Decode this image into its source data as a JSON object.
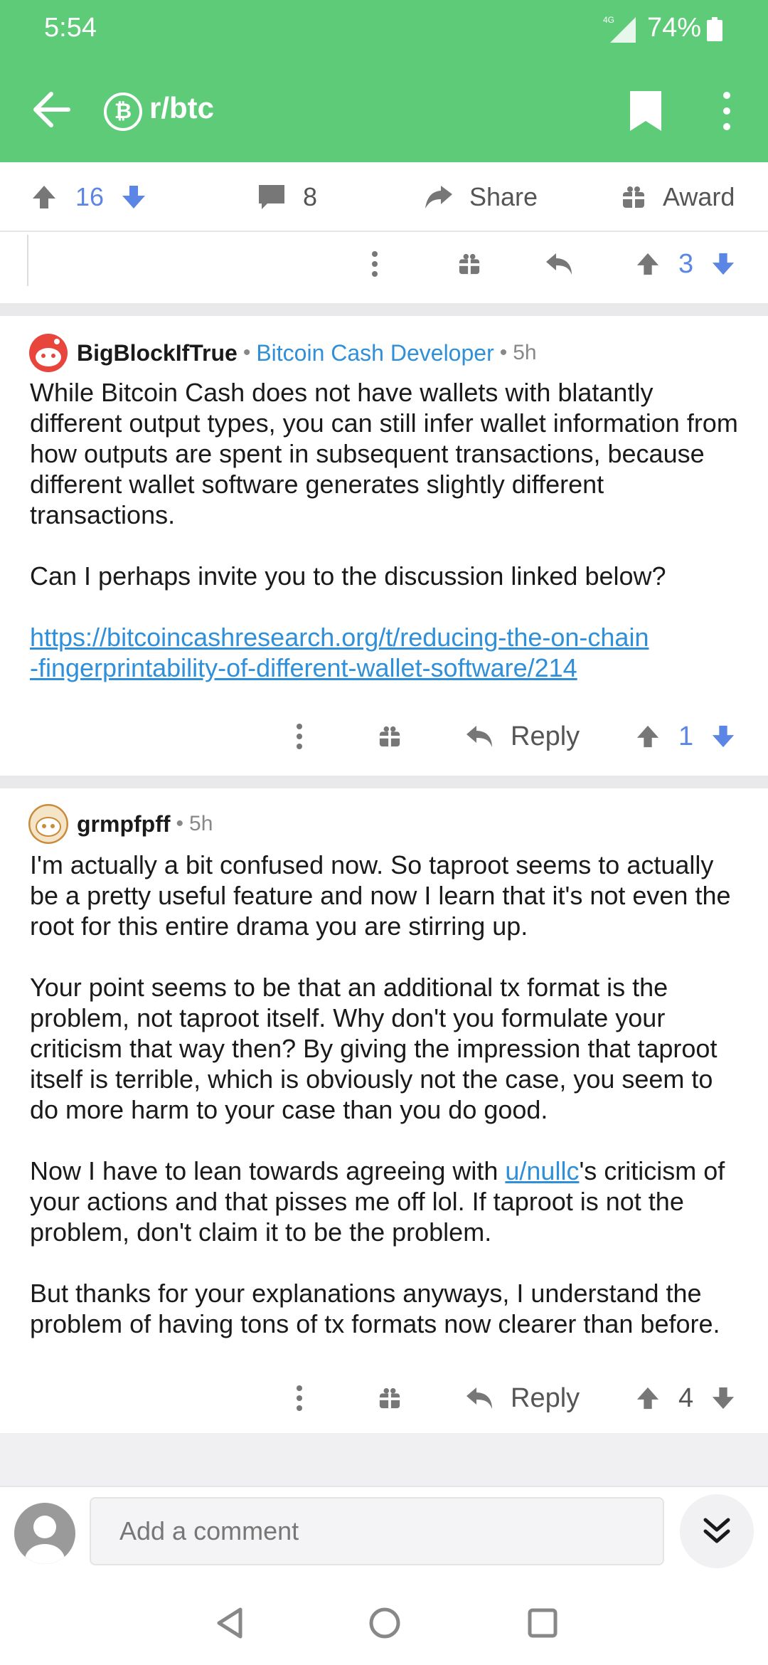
{
  "status_bar": {
    "time": "5:54",
    "network": "4G",
    "battery": "74%"
  },
  "app_bar": {
    "subreddit": "r/btc",
    "subreddit_icon": "bitcoin-icon"
  },
  "post_actions": {
    "upvotes": "16",
    "comments": "8",
    "share": "Share",
    "award": "Award"
  },
  "first_action_row": {
    "score": "3"
  },
  "comments": [
    {
      "author": "BigBlockIfTrue",
      "flair": "Bitcoin Cash Developer",
      "age": "5h",
      "paragraphs": [
        "While Bitcoin Cash does not have wallets with blatantly different output types, you can still infer wallet information from how outputs are spent in subsequent transactions, because different wallet software generates slightly different transactions.",
        "Can I perhaps invite you to the discussion linked below?"
      ],
      "link_line1": "https://bitcoincashresearch.org/t/reducing-the-on-chain",
      "link_line2": "-fingerprintability-of-different-wallet-software/214",
      "reply": "Reply",
      "score": "1"
    },
    {
      "author": "grmpfpff",
      "age": "5h",
      "paragraphs": [
        "I'm actually a bit confused now. So taproot seems to actually be a pretty useful feature and now I learn that it's not even the root for this entire drama you are stirring up.",
        "Your point seems to be that an additional tx format is the problem, not taproot itself. Why don't you formulate your criticism that way then? By giving the impression that taproot itself is terrible, which is obviously not the case, you seem to do more harm to your case than you do good."
      ],
      "p3_before": "Now I have to lean towards agreeing with ",
      "p3_link": "u/nullc",
      "p3_after": "'s criticism of your actions and that pisses me off lol. If taproot is not the problem, don't claim it to be the problem.",
      "p4": "But thanks for your explanations anyways, I understand the problem of having tons of tx formats now clearer than before.",
      "reply": "Reply",
      "score": "4"
    }
  ],
  "comment_bar": {
    "placeholder": "Add a comment"
  },
  "colors": {
    "header": "#5ecb79",
    "vote_blue": "#5b86e5",
    "link": "#2f8fd8"
  }
}
